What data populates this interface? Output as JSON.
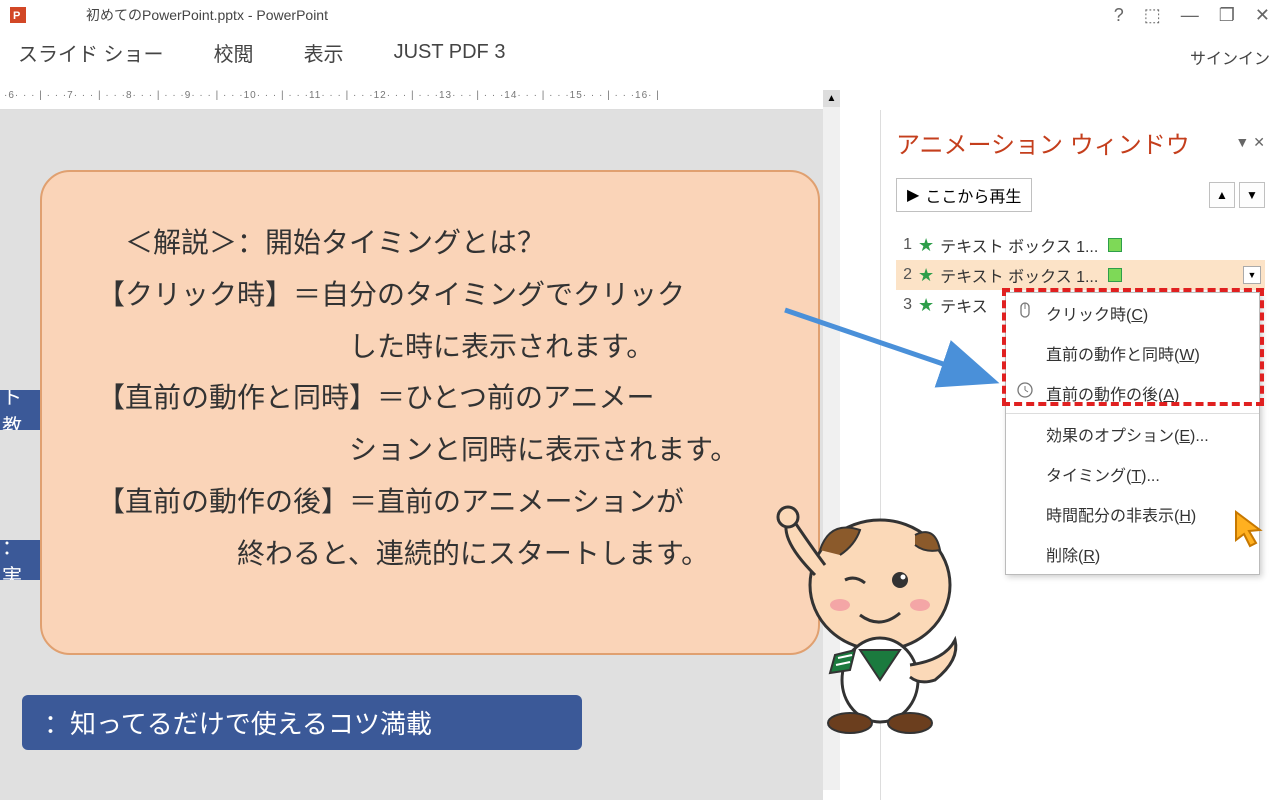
{
  "title": "初めてのPowerPoint.pptx - PowerPoint",
  "ribbon": {
    "tabs": [
      "スライド ショー",
      "校閲",
      "表示",
      "JUST PDF 3"
    ]
  },
  "signin": "サインイン",
  "ruler": "·6· · · | · · ·7· · · | · · ·8· · · | · · ·9· · · | · · ·10· · · | · · ·11· · · | · · ·12· · · | · · ·13· · · | · · ·14· · · | · · ·15· · · | · · ·16· |",
  "slide": {
    "partial1": "ト 教",
    "partial2": "：実",
    "bluebar": "：知ってるだけで使えるコツ満載"
  },
  "callout": {
    "line1": "＜解説＞：開始タイミングとは？",
    "line2": "【クリック時】＝自分のタイミングでクリック",
    "line3": "した時に表示されます。",
    "line4": "【直前の動作と同時】＝ひとつ前のアニメー",
    "line5": "ションと同時に表示されます。",
    "line6": "【直前の動作の後】＝直前のアニメーションが",
    "line7": "終わると、連続的にスタートします。"
  },
  "anim_pane": {
    "title": "アニメーション ウィンドウ",
    "play": "ここから再生",
    "items": [
      {
        "num": "1",
        "label": "テキスト ボックス 1..."
      },
      {
        "num": "2",
        "label": "テキスト ボックス 1..."
      },
      {
        "num": "3",
        "label": "テキス"
      }
    ]
  },
  "menu": {
    "click": "クリック時(",
    "click_k": "C",
    "with_prev": "直前の動作と同時(",
    "with_prev_k": "W",
    "after_prev": "直前の動作の後(",
    "after_prev_k": "A",
    "effect": "効果のオプション(",
    "effect_k": "E",
    "timing": "タイミング(",
    "timing_k": "T",
    "hide": "時間配分の非表示(",
    "hide_k": "H",
    "delete": "削除(",
    "delete_k": "R",
    "close": ")",
    "close_dots": ")..."
  }
}
